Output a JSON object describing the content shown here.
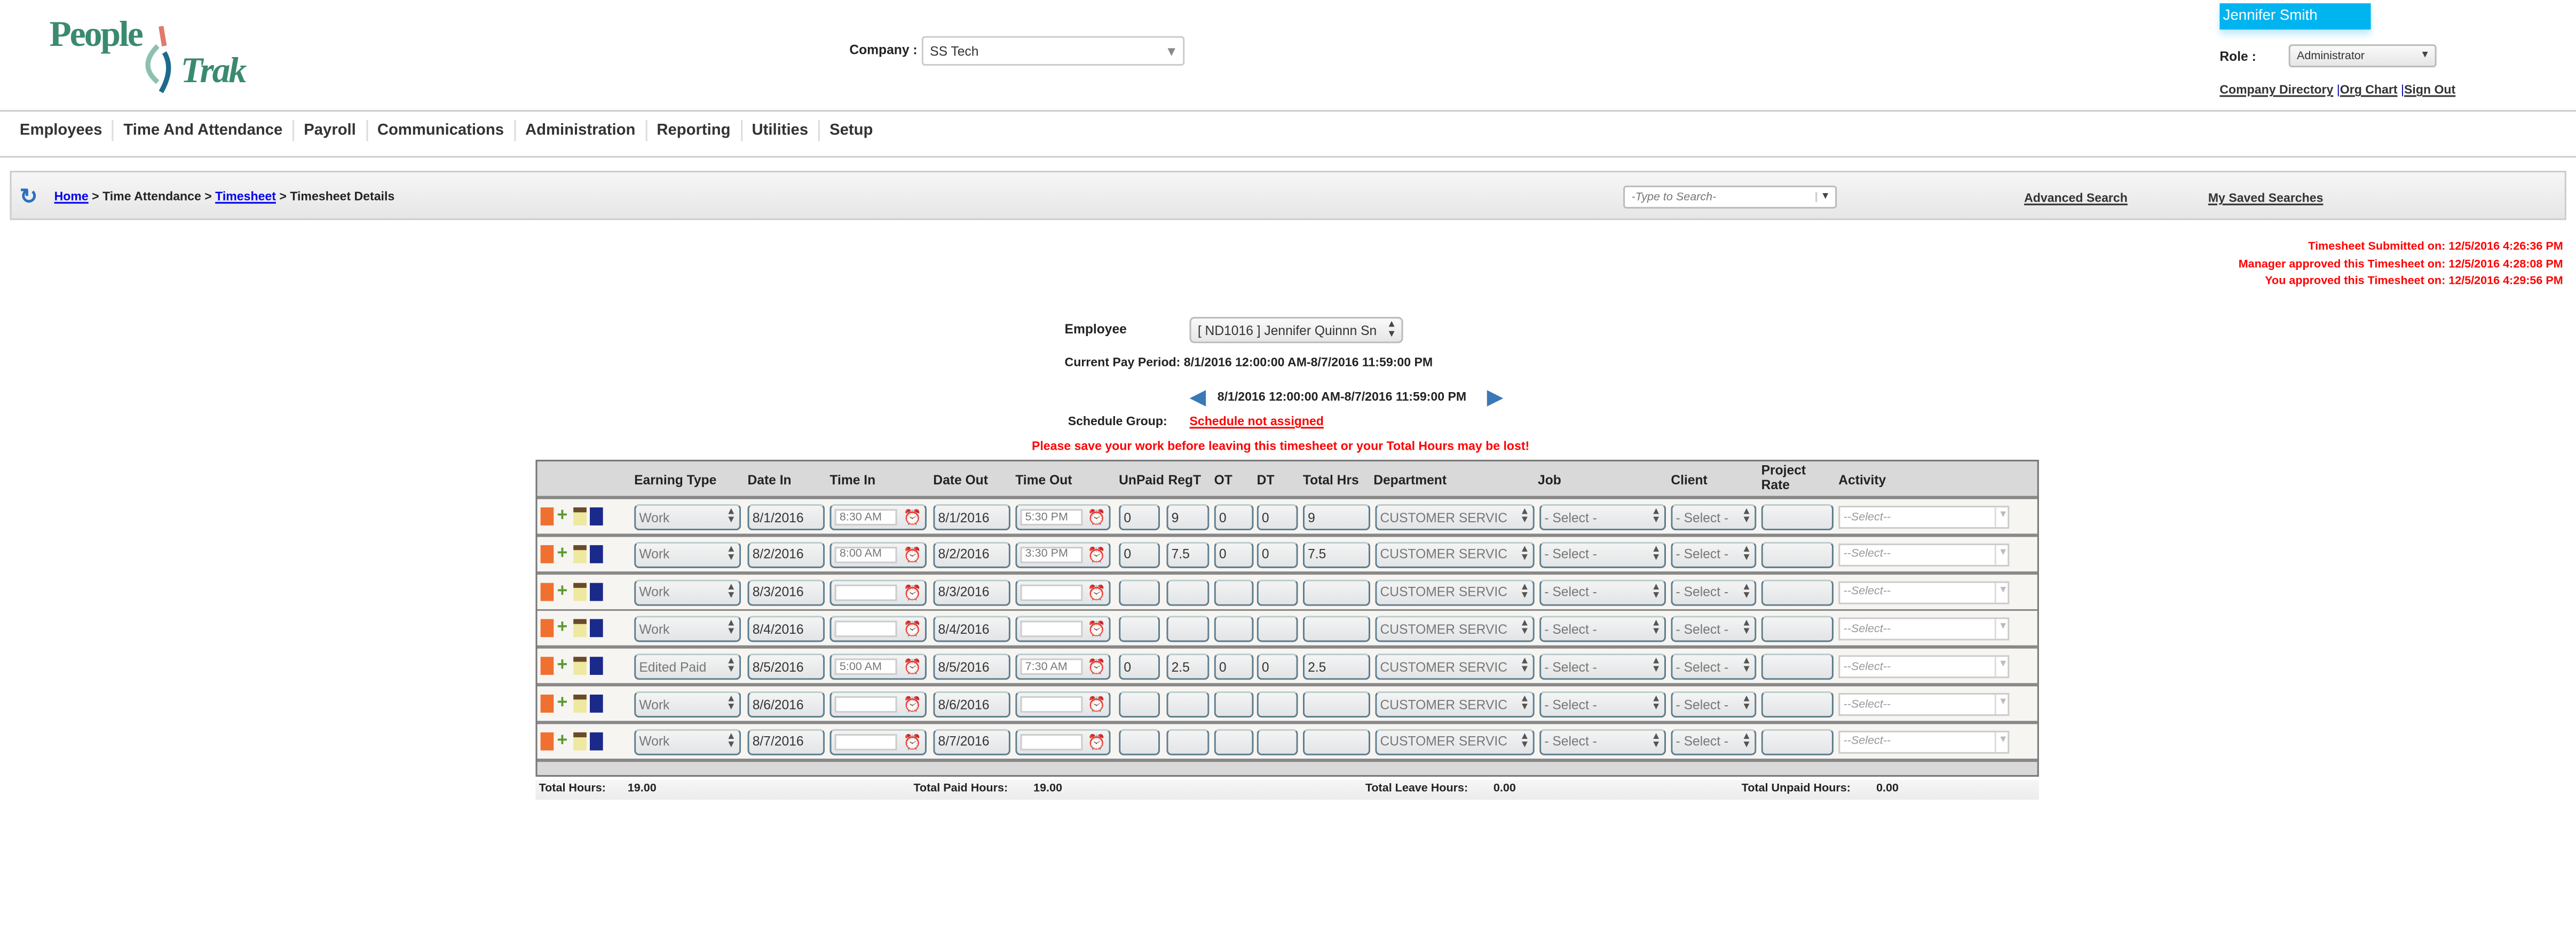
{
  "logo": {
    "line1": "People",
    "line2": "Trak"
  },
  "company": {
    "label": "Company :",
    "value": "SS Tech"
  },
  "user": {
    "name": "Jennifer Smith",
    "role_label": "Role :",
    "role": "Administrator",
    "links": [
      "Company Directory",
      "Org Chart",
      "Sign Out"
    ]
  },
  "nav": [
    "Employees",
    "Time And Attendance",
    "Payroll",
    "Communications",
    "Administration",
    "Reporting",
    "Utilities",
    "Setup"
  ],
  "breadcrumb": {
    "home": "Home",
    "sep": " > ",
    "ta": "Time Attendance",
    "timesheet": "Timesheet",
    "current": "Timesheet Details"
  },
  "search": {
    "placeholder": "-Type to Search-",
    "advanced": "Advanced Search",
    "saved": "My Saved Searches"
  },
  "status": [
    "Timesheet Submitted on: 12/5/2016 4:26:36 PM",
    "Manager approved this Timesheet on: 12/5/2016 4:28:08 PM",
    "You approved this Timesheet on: 12/5/2016 4:29:56 PM"
  ],
  "employee": {
    "label": "Employee",
    "value": "[ ND1016 ] Jennifer Quinnn Sn",
    "pay_period_label": "Current Pay Period:",
    "pay_period": "8/1/2016 12:00:00 AM-8/7/2016 11:59:00 PM",
    "period_nav": "8/1/2016 12:00:00 AM-8/7/2016 11:59:00 PM",
    "schedule_label": "Schedule Group:",
    "schedule": "Schedule not assigned",
    "warning": "Please save your work before leaving this timesheet or your Total Hours may be lost!"
  },
  "table": {
    "headers": [
      "Earning Type",
      "Date In",
      "Time In",
      "Date Out",
      "Time Out",
      "UnPaid",
      "RegT",
      "OT",
      "DT",
      "Total Hrs",
      "Department",
      "Job",
      "Client",
      "Project Rate",
      "Activity"
    ],
    "rows": [
      {
        "earning": "Work",
        "date_in": "8/1/2016",
        "time_in": "8:30 AM",
        "date_out": "8/1/2016",
        "time_out": "5:30 PM",
        "unpaid": "0",
        "regt": "9",
        "ot": "0",
        "dt": "0",
        "total": "9",
        "dept": "CUSTOMER SERVIC",
        "job": "- Select -",
        "client": "- Select -",
        "rate": "",
        "activity": "--Select--"
      },
      {
        "earning": "Work",
        "date_in": "8/2/2016",
        "time_in": "8:00 AM",
        "date_out": "8/2/2016",
        "time_out": "3:30 PM",
        "unpaid": "0",
        "regt": "7.5",
        "ot": "0",
        "dt": "0",
        "total": "7.5",
        "dept": "CUSTOMER SERVIC",
        "job": "- Select -",
        "client": "- Select -",
        "rate": "",
        "activity": "--Select--"
      },
      {
        "earning": "Work",
        "date_in": "8/3/2016",
        "time_in": "",
        "date_out": "8/3/2016",
        "time_out": "",
        "unpaid": "",
        "regt": "",
        "ot": "",
        "dt": "",
        "total": "",
        "dept": "CUSTOMER SERVIC",
        "job": "- Select -",
        "client": "- Select -",
        "rate": "",
        "activity": "--Select--"
      },
      {
        "earning": "Work",
        "date_in": "8/4/2016",
        "time_in": "",
        "date_out": "8/4/2016",
        "time_out": "",
        "unpaid": "",
        "regt": "",
        "ot": "",
        "dt": "",
        "total": "",
        "dept": "CUSTOMER SERVIC",
        "job": "- Select -",
        "client": "- Select -",
        "rate": "",
        "activity": "--Select--"
      },
      {
        "earning": "Edited Paid",
        "date_in": "8/5/2016",
        "time_in": "5:00 AM",
        "date_out": "8/5/2016",
        "time_out": "7:30 AM",
        "unpaid": "0",
        "regt": "2.5",
        "ot": "0",
        "dt": "0",
        "total": "2.5",
        "dept": "CUSTOMER SERVIC",
        "job": "- Select -",
        "client": "- Select -",
        "rate": "",
        "activity": "--Select--"
      },
      {
        "earning": "Work",
        "date_in": "8/6/2016",
        "time_in": "",
        "date_out": "8/6/2016",
        "time_out": "",
        "unpaid": "",
        "regt": "",
        "ot": "",
        "dt": "",
        "total": "",
        "dept": "CUSTOMER SERVIC",
        "job": "- Select -",
        "client": "- Select -",
        "rate": "",
        "activity": "--Select--"
      },
      {
        "earning": "Work",
        "date_in": "8/7/2016",
        "time_in": "",
        "date_out": "8/7/2016",
        "time_out": "",
        "unpaid": "",
        "regt": "",
        "ot": "",
        "dt": "",
        "total": "",
        "dept": "CUSTOMER SERVIC",
        "job": "- Select -",
        "client": "- Select -",
        "rate": "",
        "activity": "--Select--"
      }
    ]
  },
  "totals": {
    "total_label": "Total Hours:",
    "total": "19.00",
    "paid_label": "Total Paid Hours:",
    "paid": "19.00",
    "leave_label": "Total Leave Hours:",
    "leave": "0.00",
    "unpaid_label": "Total Unpaid Hours:",
    "unpaid": "0.00"
  },
  "colors": {
    "accent": "#00b4ef",
    "alert": "#ff0000",
    "link": "#0000ee"
  }
}
